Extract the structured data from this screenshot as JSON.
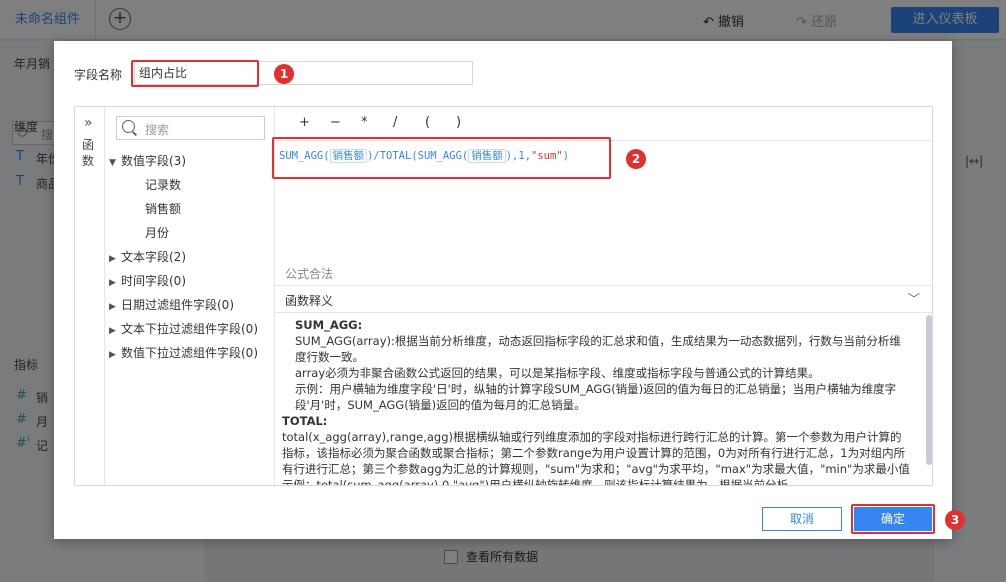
{
  "app": {
    "tab_name": "未命名组件",
    "undo_label": "撤销",
    "redo_label": "还原",
    "enter_dashboard": "进入仪表板",
    "left_panel": {
      "title": "年月销",
      "search_placeholder": "搜",
      "dimension_label": "维度",
      "dim_items": [
        "年份",
        "商品"
      ],
      "indicator_label": "指标",
      "ind_items": [
        "销",
        "月",
        "记"
      ]
    },
    "view_all_label": "查看所有数据"
  },
  "dialog": {
    "field_name_label": "字段名称",
    "field_name_value": "组内占比",
    "func_label": "函数",
    "tree": {
      "search_placeholder": "搜索",
      "groups": [
        {
          "label": "数值字段(3)",
          "expanded": true,
          "children": [
            "记录数",
            "销售额",
            "月份"
          ]
        },
        {
          "label": "文本字段(2)",
          "expanded": false
        },
        {
          "label": "时间字段(0)",
          "expanded": false
        },
        {
          "label": "日期过滤组件字段(0)",
          "expanded": false
        },
        {
          "label": "文本下拉过滤组件字段(0)",
          "expanded": false
        },
        {
          "label": "数值下拉过滤组件字段(0)",
          "expanded": false
        }
      ]
    },
    "operators": [
      "+",
      "−",
      "*",
      "/",
      "(",
      ")"
    ],
    "formula": {
      "p1": "SUM_AGG(",
      "f1": "销售额",
      "p2": ")/TOTAL(SUM_AGG(",
      "f2": "销售额",
      "p3": "),1,",
      "s1": "\"sum\"",
      "p4": ")"
    },
    "validity": "公式合法",
    "doc_title": "函数释义",
    "doc": {
      "h1": "SUM_AGG:",
      "l1": "SUM_AGG(array):根据当前分析维度，动态返回指标字段的汇总求和值，生成结果为一动态数据列，行数与当前分析维度行数一致。",
      "l2": " array必须为非聚合函数公式返回的结果，可以是某指标字段、维度或指标字段与普通公式的计算结果。",
      "l3": " 示例：用户横轴为维度字段'日'时，纵轴的计算字段SUM_AGG(销量)返回的值为每日的汇总销量；当用户横轴为维度字段'月'时，SUM_AGG(销量)返回的值为每月的汇总销量。",
      "h2": "TOTAL:",
      "l4": "total(x_agg(array),range,agg)根据横纵轴或行列维度添加的字段对指标进行跨行汇总的计算。第一个参数为用户计算的指标，该指标必须为聚合函数或聚合指标；第二个参数range为用户设置计算的范围，0为对所有行进行汇总，1为对组内所有行进行汇总；第三个参数agg为汇总的计算规则，\"sum\"为求和；\"avg\"为求平均，\"max\"为求最大值，\"min\"为求最小值示例：total(sum_agg(array),0,\"avg\")用户横纵轴旋转维度，则该指标计算结果为，根据当前分析"
    },
    "cancel_label": "取消",
    "ok_label": "确定"
  },
  "badges": [
    "1",
    "2",
    "3"
  ],
  "colors": {
    "accent": "#3685f2",
    "highlight": "#e0312f"
  }
}
